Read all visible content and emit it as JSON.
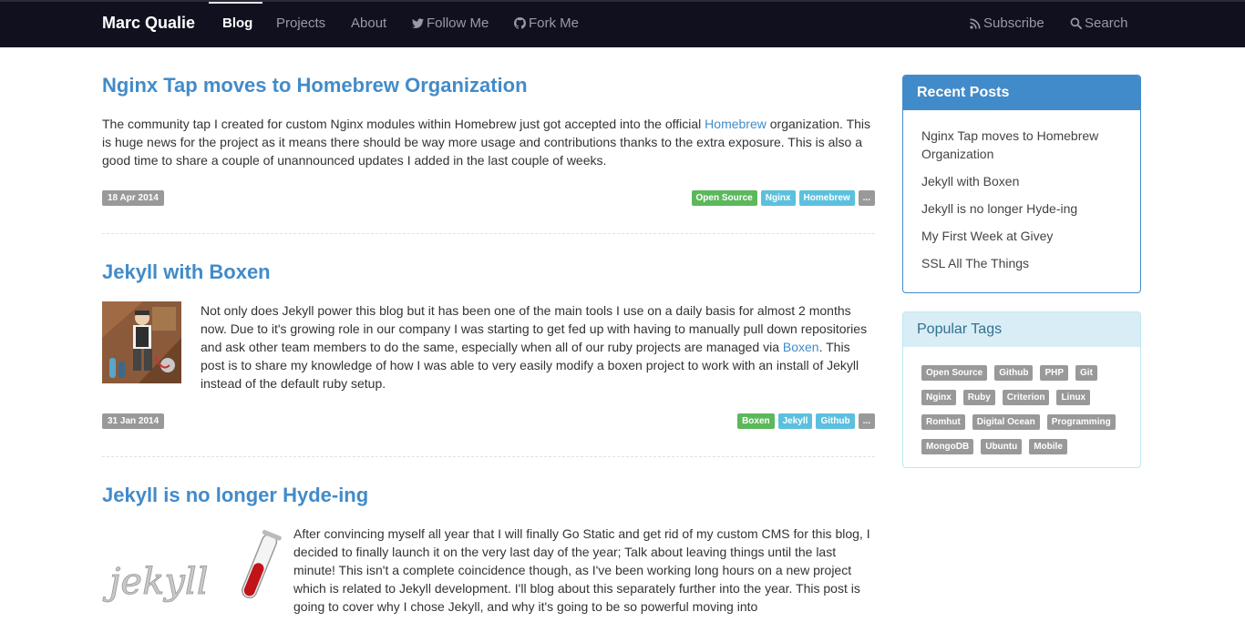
{
  "nav": {
    "brand": "Marc Qualie",
    "items": [
      "Blog",
      "Projects",
      "About",
      "Follow Me",
      "Fork Me"
    ],
    "right": [
      "Subscribe",
      "Search"
    ]
  },
  "posts": [
    {
      "title": "Nginx Tap moves to Homebrew Organization",
      "body_pre": "The community tap I created for custom Nginx modules within Homebrew just got accepted into the official ",
      "body_link": "Homebrew",
      "body_post": " organization. This is huge news for the project as it means there should be way more usage and contributions thanks to the extra exposure. This is also a good time to share a couple of unannounced updates I added in the last couple of weeks.",
      "date": "18 Apr 2014",
      "tags": [
        "Open Source",
        "Nginx",
        "Homebrew",
        "..."
      ]
    },
    {
      "title": "Jekyll with Boxen",
      "body_pre": "Not only does Jekyll power this blog but it has been one of the main tools I use on a daily basis for almost 2 months now. Due to it's growing role in our company I was starting to get fed up with having to manually pull down repositories and ask other team members to do the same, especially when all of our ruby projects are managed via ",
      "body_link": "Boxen",
      "body_post": ". This post is to share my knowledge of how I was able to very easily modify a boxen project to work with an install of Jekyll instead of the default ruby setup.",
      "date": "31 Jan 2014",
      "tags": [
        "Boxen",
        "Jekyll",
        "Github",
        "..."
      ]
    },
    {
      "title": "Jekyll is no longer Hyde-ing",
      "body": "After convincing myself all year that I will finally Go Static and get rid of my custom CMS for this blog, I decided to finally launch it on the very last day of the year; Talk about leaving things until the last minute! This isn't a complete coincidence though, as I've been working long hours on a new project which is related to Jekyll development. I'll blog about this separately further into the year. This post is going to cover why I chose Jekyll, and why it's going to be so powerful moving into"
    }
  ],
  "sidebar": {
    "recent_title": "Recent Posts",
    "recent_posts": [
      "Nginx Tap moves to Homebrew Organization",
      "Jekyll with Boxen",
      "Jekyll is no longer Hyde-ing",
      "My First Week at Givey",
      "SSL All The Things"
    ],
    "tags_title": "Popular Tags",
    "tags": [
      "Open Source",
      "Github",
      "PHP",
      "Git",
      "Nginx",
      "Ruby",
      "Criterion",
      "Linux",
      "Romhut",
      "Digital Ocean",
      "Programming",
      "MongoDB",
      "Ubuntu",
      "Mobile"
    ]
  },
  "colors": {
    "nav_bg": "#10101e",
    "link": "#428bca",
    "tag_success": "#5cb85c",
    "tag_info": "#5bc0de",
    "tag_default": "#999999"
  },
  "icons": {
    "follow": "twitter-icon",
    "fork": "github-icon",
    "subscribe": "rss-icon",
    "search": "search-icon"
  }
}
